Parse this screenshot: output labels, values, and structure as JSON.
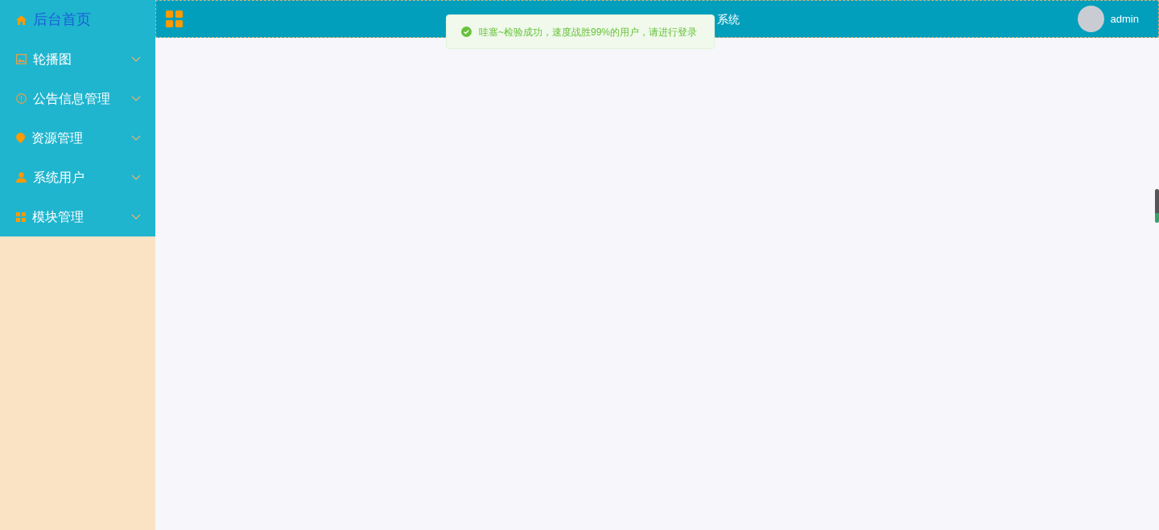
{
  "sidebar": {
    "items": [
      {
        "label": "后台首页",
        "kind": "link",
        "selected": true
      },
      {
        "label": "轮播图",
        "kind": "submenu",
        "selected": false
      },
      {
        "label": "公告信息管理",
        "kind": "submenu",
        "selected": false
      },
      {
        "label": "资源管理",
        "kind": "submenu",
        "selected": false
      },
      {
        "label": "系统用户",
        "kind": "submenu",
        "selected": false
      },
      {
        "label": "模块管理",
        "kind": "submenu",
        "selected": false
      }
    ]
  },
  "header": {
    "title": "系统",
    "user": "admin"
  },
  "toast": {
    "message": "哇塞~检验成功，速度战胜99%的用户，请进行登录"
  }
}
